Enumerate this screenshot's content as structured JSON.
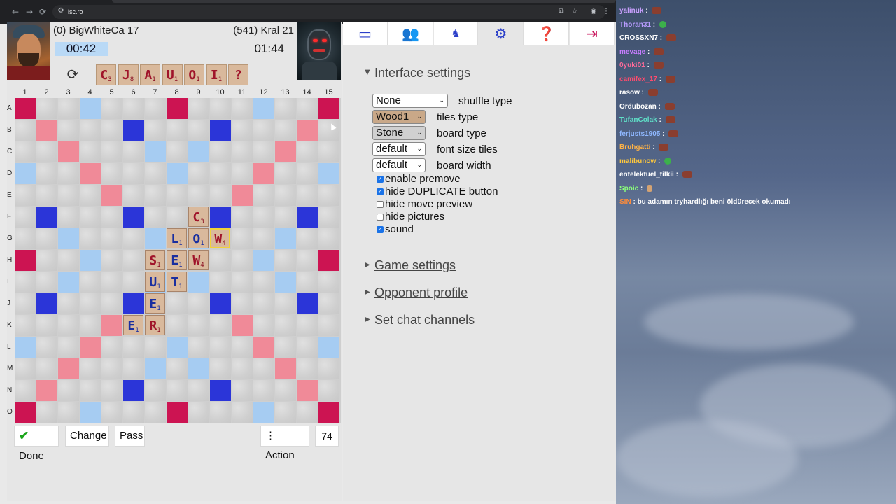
{
  "browser": {
    "url": "isc.ro",
    "nav": {
      "back": "←",
      "forward": "→",
      "reload": "⟳"
    },
    "icons": [
      "site-info-icon",
      "install-app-icon",
      "bookmark-star-icon",
      "profile-icon",
      "menu-icon"
    ]
  },
  "players": {
    "left": {
      "label": "(0) BigWhiteCa 17",
      "timer": "00:42"
    },
    "right": {
      "label": "(541) Kral 21",
      "timer": "01:44"
    }
  },
  "rack": [
    {
      "letter": "C",
      "score": "3"
    },
    {
      "letter": "J",
      "score": "8"
    },
    {
      "letter": "A",
      "score": "1"
    },
    {
      "letter": "U",
      "score": "1"
    },
    {
      "letter": "O",
      "score": "1"
    },
    {
      "letter": "I",
      "score": "1"
    },
    {
      "letter": "?",
      "score": ""
    }
  ],
  "board": {
    "columns": [
      "1",
      "2",
      "3",
      "4",
      "5",
      "6",
      "7",
      "8",
      "9",
      "10",
      "11",
      "12",
      "13",
      "14",
      "15"
    ],
    "rows": [
      "A",
      "B",
      "C",
      "D",
      "E",
      "F",
      "G",
      "H",
      "I",
      "J",
      "K",
      "L",
      "M",
      "N",
      "O"
    ],
    "placed": [
      {
        "cell": "F9",
        "letter": "C",
        "score": "3",
        "color": "red"
      },
      {
        "cell": "G8",
        "letter": "L",
        "score": "1",
        "color": "blue"
      },
      {
        "cell": "G9",
        "letter": "O",
        "score": "1",
        "color": "blue"
      },
      {
        "cell": "G10",
        "letter": "W",
        "score": "4",
        "color": "red",
        "highlight": true
      },
      {
        "cell": "H7",
        "letter": "S",
        "score": "1",
        "color": "red"
      },
      {
        "cell": "H8",
        "letter": "E",
        "score": "1",
        "color": "blue"
      },
      {
        "cell": "H9",
        "letter": "W",
        "score": "4",
        "color": "red"
      },
      {
        "cell": "I7",
        "letter": "U",
        "score": "1",
        "color": "blue"
      },
      {
        "cell": "I8",
        "letter": "T",
        "score": "1",
        "color": "blue"
      },
      {
        "cell": "J7",
        "letter": "E",
        "score": "1",
        "color": "blue"
      },
      {
        "cell": "K6",
        "letter": "E",
        "score": "1",
        "color": "blue"
      },
      {
        "cell": "K7",
        "letter": "R",
        "score": "1",
        "color": "red"
      }
    ]
  },
  "buttons": {
    "done": "Done",
    "change": "Change",
    "pass": "Pass",
    "action": "Action",
    "bag_count": "74"
  },
  "side_tabs": [
    "window-icon",
    "users-icon",
    "game-icon",
    "settings-icon",
    "help-icon",
    "exit-icon"
  ],
  "settings": {
    "interface_title": "Interface settings",
    "shuffle": {
      "value": "None",
      "label": "shuffle type"
    },
    "tiles": {
      "value": "Wood1",
      "label": "tiles type"
    },
    "board_type": {
      "value": "Stone",
      "label": "board type"
    },
    "font_size": {
      "value": "default",
      "label": "font size tiles"
    },
    "board_width": {
      "value": "default",
      "label": "board width"
    },
    "checks": [
      {
        "label": "enable premove",
        "checked": true
      },
      {
        "label": "hide DUPLICATE button",
        "checked": true
      },
      {
        "label": "hide move preview",
        "checked": false
      },
      {
        "label": "hide pictures",
        "checked": false
      },
      {
        "label": "sound",
        "checked": true
      }
    ],
    "game_title": "Game settings",
    "opponent_title": "Opponent profile",
    "chat_title": "Set chat channels"
  },
  "chat": [
    {
      "name": "yalinuk",
      "color": "#c9a0ff",
      "msg": "",
      "emote": "brown"
    },
    {
      "name": "Thoran31",
      "color": "#b89cff",
      "msg": "",
      "emote": "green"
    },
    {
      "name": "CROSSXN7",
      "color": "#ffffff",
      "msg": "",
      "emote": "brown"
    },
    {
      "name": "mevage",
      "color": "#c77dff",
      "msg": "",
      "emote": "brown"
    },
    {
      "name": "0yuki01",
      "color": "#ff6b9a",
      "msg": "",
      "emote": "brown"
    },
    {
      "name": "camifex_17",
      "color": "#ff4b6e",
      "msg": "",
      "emote": "brown"
    },
    {
      "name": "rasow",
      "color": "#ffffff",
      "msg": "",
      "emote": "brown"
    },
    {
      "name": "Ordubozan",
      "color": "#ffffff",
      "msg": "",
      "emote": "brown"
    },
    {
      "name": "TufanColak",
      "color": "#5fe0c8",
      "msg": "",
      "emote": "brown"
    },
    {
      "name": "ferjusts1905",
      "color": "#8fb8ff",
      "msg": "",
      "emote": "brown"
    },
    {
      "name": "Bruhgatti",
      "color": "#ffb347",
      "msg": "",
      "emote": "brown"
    },
    {
      "name": "malibunow",
      "color": "#ffc83d",
      "msg": "",
      "emote": "green"
    },
    {
      "name": "entelektuel_tilkii",
      "color": "#ffffff",
      "msg": "",
      "emote": "brown"
    },
    {
      "name": "Spoic",
      "color": "#8bff7a",
      "msg": "",
      "emote": "hand"
    },
    {
      "name": "SIN",
      "color": "#ff8c3a",
      "msg": "bu adamın tryhardlığı beni öldürecek okumadı",
      "emote": ""
    }
  ]
}
